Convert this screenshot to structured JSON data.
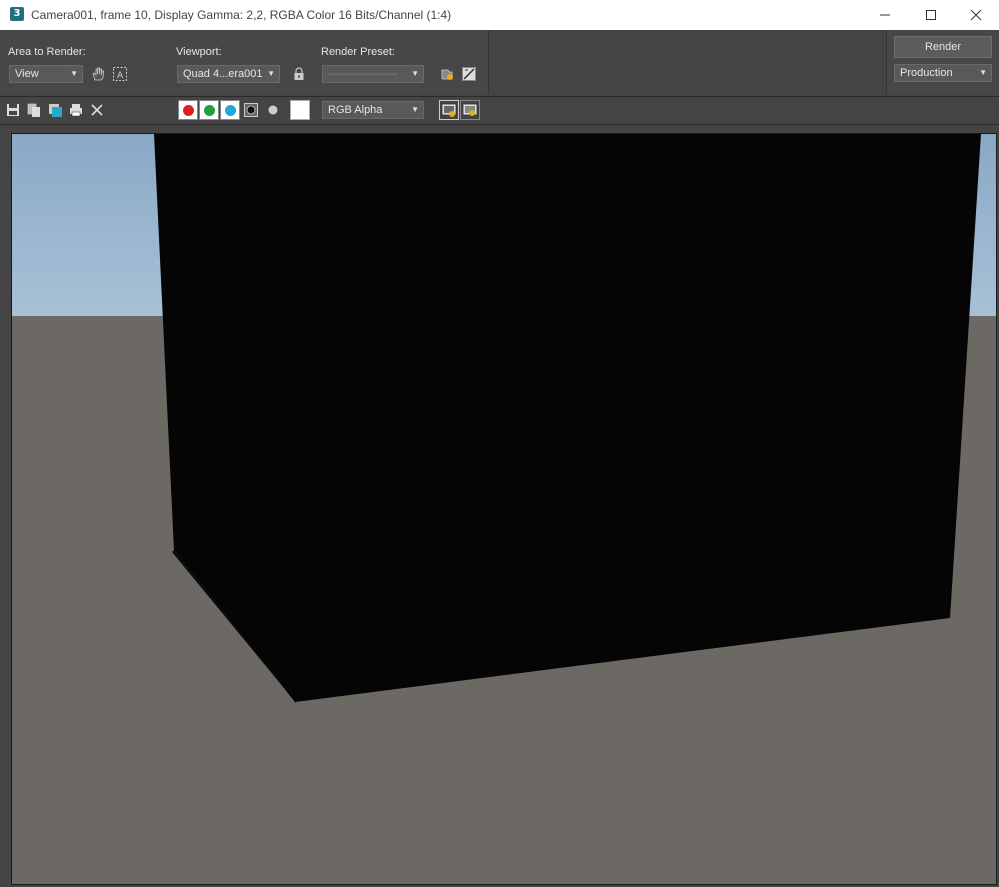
{
  "window": {
    "title": "Camera001, frame 10, Display Gamma: 2,2, RGBA Color 16 Bits/Channel (1:4)",
    "app_icon_label": "3"
  },
  "topbar": {
    "area_to_render_label": "Area to Render:",
    "area_to_render_value": "View",
    "viewport_label": "Viewport:",
    "viewport_value": "Quad 4...era001",
    "render_preset_label": "Render Preset:",
    "render_preset_value": "-------------------",
    "render_button": "Render",
    "production_value": "Production"
  },
  "toolbar": {
    "channel_value": "RGB Alpha"
  },
  "colors": {
    "red_channel": "#e02020",
    "green_channel": "#20a040",
    "blue_channel": "#20a8d8",
    "sky": "#96b2cc",
    "ground": "#6c6965",
    "box": "#050505"
  }
}
